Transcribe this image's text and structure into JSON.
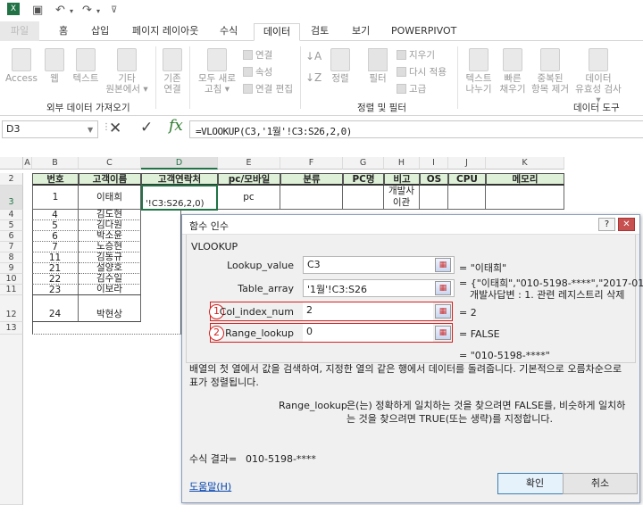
{
  "ribbon": {
    "tabs": [
      {
        "label": "파일"
      },
      {
        "label": "홈"
      },
      {
        "label": "삽입"
      },
      {
        "label": "페이지 레이아웃"
      },
      {
        "label": "수식"
      },
      {
        "label": "데이터"
      },
      {
        "label": "검토"
      },
      {
        "label": "보기"
      },
      {
        "label": "POWERPIVOT"
      }
    ],
    "active_tab": "데이터",
    "buttons": {
      "access": "Access",
      "web": "웹",
      "text": "텍스트",
      "other": "기타",
      "other2": "원본에서 ▾",
      "existing": "기존",
      "existing2": "연결",
      "refresh": "모두 새로",
      "refresh2": "고침 ▾",
      "conn": "연결",
      "props": "속성",
      "edit_links": "연결 편집",
      "sort_az": "",
      "sort": "정렬",
      "filter": "필터",
      "clear": "지우기",
      "reapply": "다시 적용",
      "advanced": "고급",
      "text_to_col": "텍스트",
      "text_to_col2": "나누기",
      "flash": "빠른",
      "flash2": "채우기",
      "dup": "중복된",
      "dup2": "항목 제거",
      "valid": "데이터",
      "valid2": "유효성 검사 ▾"
    },
    "groups": {
      "external": "외부 데이터 가져오기",
      "sortfilter": "정렬 및 필터",
      "tools": "데이터 도구"
    }
  },
  "formula_bar": {
    "name_box": "D3",
    "formula": "=VLOOKUP(C3,'1월'!C3:S26,2,0)"
  },
  "sheet": {
    "columns": [
      "A",
      "B",
      "C",
      "D",
      "E",
      "F",
      "G",
      "H",
      "I",
      "J",
      "K"
    ],
    "rows": [
      "2",
      "3",
      "4",
      "5",
      "6",
      "7",
      "8",
      "9",
      "10",
      "11",
      "12",
      "13"
    ],
    "headers": [
      "번호",
      "고객이름",
      "고객연락처",
      "pc/모바일",
      "분류",
      "PC명",
      "비고",
      "OS",
      "CPU",
      "메모리"
    ],
    "row3": {
      "num": "1",
      "name": "이태희",
      "d3": "'!C3:S26,2,0)",
      "type": "pc",
      "note": "개발사 이관"
    },
    "records": [
      {
        "num": "4",
        "name": "김도현"
      },
      {
        "num": "5",
        "name": "김다원"
      },
      {
        "num": "6",
        "name": "박소윤"
      },
      {
        "num": "7",
        "name": "노승현"
      },
      {
        "num": "11",
        "name": "김동규"
      },
      {
        "num": "21",
        "name": "설양호"
      },
      {
        "num": "22",
        "name": "김수일"
      },
      {
        "num": "23",
        "name": "이보라"
      },
      {
        "num": "24",
        "name": "박현상"
      }
    ]
  },
  "dialog": {
    "title": "함수 인수",
    "help_glyph": "?",
    "close_glyph": "✕",
    "function": "VLOOKUP",
    "args": [
      {
        "label": "Lookup_value",
        "value": "C3",
        "result": "\"이태희\""
      },
      {
        "label": "Table_array",
        "value": "'1월'!C3:S26",
        "result": "{\"이태희\",\"010-5198-****\",\"2017-01",
        "result2": "개발사답변 : 1. 관련 레지스트리 삭제"
      },
      {
        "label": "Col_index_num",
        "value": "2",
        "result": "2",
        "marker": "1"
      },
      {
        "label": "Range_lookup",
        "value": "0",
        "result": "FALSE",
        "marker": "2"
      }
    ],
    "overall_result": "= \"010-5198-****\"",
    "description": "배열의 첫 열에서 값을 검색하여, 지정한 열의 같은 행에서 데이터를 돌려줍니다. 기본적으로 오름차순으로 표가 정렬됩니다.",
    "arg_help_name": "Range_lookup",
    "arg_help_text": "은(는) 정확하게 일치하는 것을 찾으려면 FALSE를, 비슷하게 일치하는 것을 찾으려면 TRUE(또는 생략)를 지정합니다.",
    "formula_result_label": "수식 결과=",
    "formula_result_value": "010-5198-****",
    "help_link": "도움말(H)",
    "ok": "확인",
    "cancel": "취소"
  },
  "colors": {
    "accent": "#217346",
    "header_fill": "#dff0d8",
    "marker": "#d62020"
  }
}
